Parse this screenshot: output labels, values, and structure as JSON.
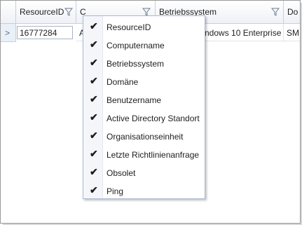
{
  "columns": [
    {
      "label": "ResourceID"
    },
    {
      "label": "C"
    },
    {
      "label": "Betriebssystem"
    },
    {
      "label": "Do"
    }
  ],
  "row": {
    "resource_id": "16777284",
    "computername": "A",
    "betriebssystem": "ndows 10 Enterprise",
    "domaene": "SM"
  },
  "column_menu": {
    "items": [
      {
        "label": "ResourceID",
        "checked": true,
        "check": "✔"
      },
      {
        "label": "Computername",
        "checked": true,
        "check": "✔"
      },
      {
        "label": "Betriebssystem",
        "checked": true,
        "check": "✔"
      },
      {
        "label": "Domäne",
        "checked": true,
        "check": "✔"
      },
      {
        "label": "Benutzername",
        "checked": true,
        "check": "✔"
      },
      {
        "label": "Active Directory Standort",
        "checked": true,
        "check": "✔"
      },
      {
        "label": "Organisationseinheit",
        "checked": true,
        "check": "✔"
      },
      {
        "label": "Letzte Richtlinienanfrage",
        "checked": true,
        "check": "✔"
      },
      {
        "label": "Obsolet",
        "checked": true,
        "check": "✔"
      },
      {
        "label": "Ping",
        "checked": true,
        "check": "✔"
      }
    ]
  },
  "icons": {
    "filter": "funnel-filter-icon",
    "row_indicator": "chevron-right-icon"
  }
}
